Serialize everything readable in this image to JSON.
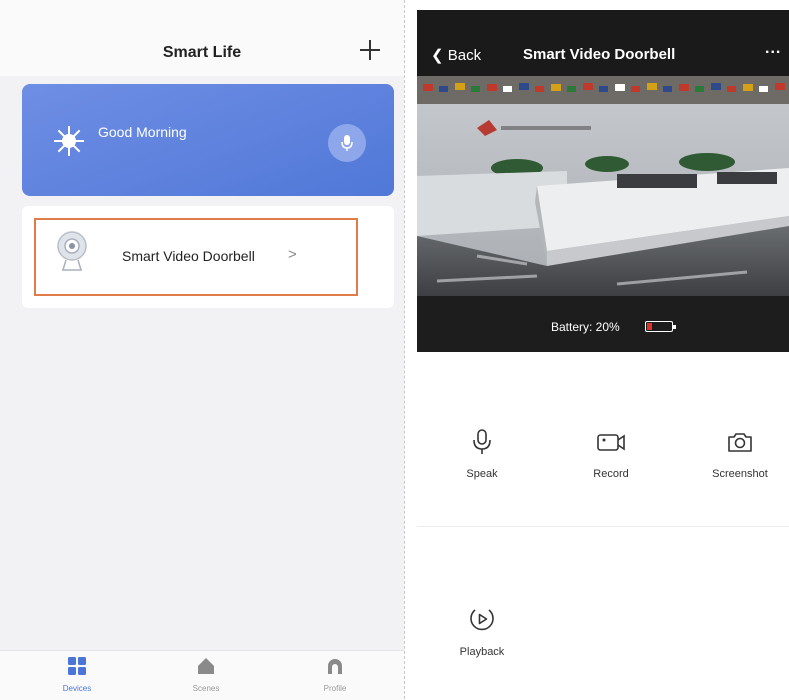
{
  "left_screen": {
    "title": "Smart Life",
    "greeting": "Good Morning",
    "device": {
      "name": "Smart  Video Doorbell",
      "chevron": ">"
    },
    "tabs": [
      {
        "label": "Devices",
        "icon": "grid-icon",
        "active": true
      },
      {
        "label": "Scenes",
        "icon": "home-icon",
        "active": false
      },
      {
        "label": "Profile",
        "icon": "profile-icon",
        "active": false
      }
    ],
    "colors": {
      "accent": "#4b76d8",
      "selection_border": "#e07b4a"
    }
  },
  "right_screen": {
    "header": {
      "back_label": "Back",
      "title": "Smart  Video Doorbell",
      "more": "..."
    },
    "battery": {
      "text": "Battery: 20%",
      "level": 0.2,
      "color": "#e0322a"
    },
    "controls": [
      {
        "label": "Speak",
        "icon": "microphone-icon"
      },
      {
        "label": "Record",
        "icon": "video-camera-icon"
      },
      {
        "label": "Screenshot",
        "icon": "camera-icon"
      },
      {
        "label": "Playback",
        "icon": "playback-icon"
      }
    ]
  }
}
